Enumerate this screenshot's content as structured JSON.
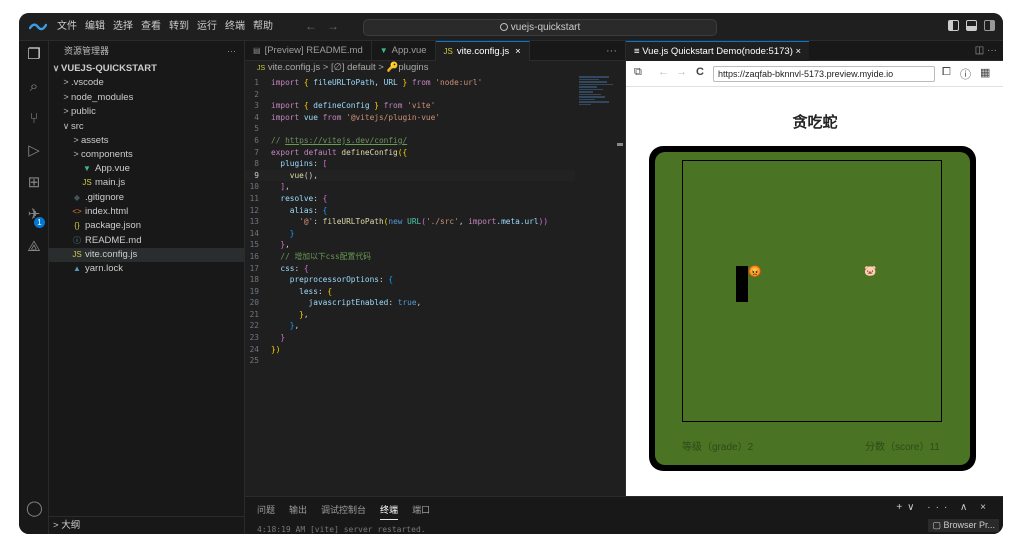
{
  "menu": [
    "文件",
    "编辑",
    "选择",
    "查看",
    "转到",
    "运行",
    "终端",
    "帮助"
  ],
  "nav": {
    "back": "←",
    "forward": "→"
  },
  "search": {
    "text": "vuejs-quickstart"
  },
  "explorer": {
    "header": "资源管理器",
    "more": "···",
    "project": "VUEJS-QUICKSTART",
    "items": [
      {
        "label": ".vscode",
        "chev": ">",
        "icon": "",
        "indent": 1,
        "color": "#cccccc"
      },
      {
        "label": "node_modules",
        "chev": ">",
        "icon": "",
        "indent": 1,
        "color": "#cccccc"
      },
      {
        "label": "public",
        "chev": ">",
        "icon": "",
        "indent": 1,
        "color": "#cccccc"
      },
      {
        "label": "src",
        "chev": "∨",
        "icon": "",
        "indent": 1,
        "color": "#cccccc"
      },
      {
        "label": "assets",
        "chev": ">",
        "icon": "",
        "indent": 2,
        "color": "#cccccc"
      },
      {
        "label": "components",
        "chev": ">",
        "icon": "",
        "indent": 2,
        "color": "#cccccc"
      },
      {
        "label": "App.vue",
        "chev": "",
        "icon": "▼",
        "iconColor": "#41b883",
        "indent": 2,
        "color": "#cccccc"
      },
      {
        "label": "main.js",
        "chev": "",
        "icon": "JS",
        "iconColor": "#cbcb41",
        "indent": 2,
        "color": "#cccccc"
      },
      {
        "label": ".gitignore",
        "chev": "",
        "icon": "◆",
        "iconColor": "#41535b",
        "indent": 1,
        "color": "#cccccc"
      },
      {
        "label": "index.html",
        "chev": "",
        "icon": "<>",
        "iconColor": "#e37933",
        "indent": 1,
        "color": "#cccccc"
      },
      {
        "label": "package.json",
        "chev": "",
        "icon": "{}",
        "iconColor": "#cbcb41",
        "indent": 1,
        "color": "#cccccc"
      },
      {
        "label": "README.md",
        "chev": "",
        "icon": "ⓘ",
        "iconColor": "#519aba",
        "indent": 1,
        "color": "#cccccc"
      },
      {
        "label": "vite.config.js",
        "chev": "",
        "icon": "JS",
        "iconColor": "#cbcb41",
        "indent": 1,
        "color": "#cccccc",
        "selected": true
      },
      {
        "label": "yarn.lock",
        "chev": "",
        "icon": "▲",
        "iconColor": "#519aba",
        "indent": 1,
        "color": "#cccccc"
      }
    ],
    "outline": "大纲"
  },
  "tabs": [
    {
      "label": "[Preview] README.md",
      "icon": "▤",
      "iconColor": "#8a8a8a"
    },
    {
      "label": "App.vue",
      "icon": "▼",
      "iconColor": "#41b883"
    },
    {
      "label": "vite.config.js",
      "icon": "JS",
      "iconColor": "#cbcb41",
      "active": true,
      "close": "×"
    }
  ],
  "breadcrumb": {
    "file": "vite.config.js",
    "sep1": ">",
    "item1": "[∅] default",
    "sep2": ">",
    "item2": "plugins"
  },
  "code": [
    [
      {
        "t": "import ",
        "c": "#c586c0"
      },
      {
        "t": "{ ",
        "c": "#ffd700"
      },
      {
        "t": "fileURLToPath",
        "c": "#9cdcfe"
      },
      {
        "t": ", ",
        "c": "#d4d4d4"
      },
      {
        "t": "URL ",
        "c": "#9cdcfe"
      },
      {
        "t": "} ",
        "c": "#ffd700"
      },
      {
        "t": "from ",
        "c": "#c586c0"
      },
      {
        "t": "'node:url'",
        "c": "#ce9178"
      }
    ],
    [],
    [
      {
        "t": "import ",
        "c": "#c586c0"
      },
      {
        "t": "{ ",
        "c": "#ffd700"
      },
      {
        "t": "defineConfig ",
        "c": "#9cdcfe"
      },
      {
        "t": "} ",
        "c": "#ffd700"
      },
      {
        "t": "from ",
        "c": "#c586c0"
      },
      {
        "t": "'vite'",
        "c": "#ce9178"
      }
    ],
    [
      {
        "t": "import ",
        "c": "#c586c0"
      },
      {
        "t": "vue ",
        "c": "#9cdcfe"
      },
      {
        "t": "from ",
        "c": "#c586c0"
      },
      {
        "t": "'@vitejs/plugin-vue'",
        "c": "#ce9178"
      }
    ],
    [],
    [
      {
        "t": "// ",
        "c": "#6a9955"
      },
      {
        "t": "https://vitejs.dev/config/",
        "c": "#6a9955",
        "u": true
      }
    ],
    [
      {
        "t": "export ",
        "c": "#c586c0"
      },
      {
        "t": "default ",
        "c": "#c586c0"
      },
      {
        "t": "defineConfig",
        "c": "#dcdcaa"
      },
      {
        "t": "({",
        "c": "#ffd700"
      }
    ],
    [
      {
        "t": "  plugins",
        "c": "#9cdcfe"
      },
      {
        "t": ": ",
        "c": "#d4d4d4"
      },
      {
        "t": "[",
        "c": "#da70d6"
      }
    ],
    [
      {
        "t": "    vue",
        "c": "#dcdcaa"
      },
      {
        "t": "(),",
        "c": "#d4d4d4"
      }
    ],
    [
      {
        "t": "  ]",
        "c": "#da70d6"
      },
      {
        "t": ",",
        "c": "#d4d4d4"
      }
    ],
    [
      {
        "t": "  resolve",
        "c": "#9cdcfe"
      },
      {
        "t": ": ",
        "c": "#d4d4d4"
      },
      {
        "t": "{",
        "c": "#da70d6"
      }
    ],
    [
      {
        "t": "    alias",
        "c": "#9cdcfe"
      },
      {
        "t": ": ",
        "c": "#d4d4d4"
      },
      {
        "t": "{",
        "c": "#179fff"
      }
    ],
    [
      {
        "t": "      '@'",
        "c": "#ce9178"
      },
      {
        "t": ": ",
        "c": "#d4d4d4"
      },
      {
        "t": "fileURLToPath",
        "c": "#dcdcaa"
      },
      {
        "t": "(",
        "c": "#ffd700"
      },
      {
        "t": "new ",
        "c": "#569cd6"
      },
      {
        "t": "URL",
        "c": "#4ec9b0"
      },
      {
        "t": "(",
        "c": "#da70d6"
      },
      {
        "t": "'./src'",
        "c": "#ce9178"
      },
      {
        "t": ", ",
        "c": "#d4d4d4"
      },
      {
        "t": "import",
        "c": "#c586c0"
      },
      {
        "t": ".meta.url",
        "c": "#9cdcfe"
      },
      {
        "t": "))",
        "c": "#da70d6"
      }
    ],
    [
      {
        "t": "    }",
        "c": "#179fff"
      }
    ],
    [
      {
        "t": "  }",
        "c": "#da70d6"
      },
      {
        "t": ",",
        "c": "#d4d4d4"
      }
    ],
    [
      {
        "t": "  // 增加以下css配置代码",
        "c": "#6a9955"
      }
    ],
    [
      {
        "t": "  css",
        "c": "#9cdcfe"
      },
      {
        "t": ": ",
        "c": "#d4d4d4"
      },
      {
        "t": "{",
        "c": "#da70d6"
      }
    ],
    [
      {
        "t": "    preprocessorOptions",
        "c": "#9cdcfe"
      },
      {
        "t": ": ",
        "c": "#d4d4d4"
      },
      {
        "t": "{",
        "c": "#179fff"
      }
    ],
    [
      {
        "t": "      less",
        "c": "#9cdcfe"
      },
      {
        "t": ": ",
        "c": "#d4d4d4"
      },
      {
        "t": "{",
        "c": "#ffd700"
      }
    ],
    [
      {
        "t": "        javascriptEnabled",
        "c": "#9cdcfe"
      },
      {
        "t": ": ",
        "c": "#d4d4d4"
      },
      {
        "t": "true",
        "c": "#569cd6"
      },
      {
        "t": ",",
        "c": "#d4d4d4"
      }
    ],
    [
      {
        "t": "      }",
        "c": "#ffd700"
      },
      {
        "t": ",",
        "c": "#d4d4d4"
      }
    ],
    [
      {
        "t": "    }",
        "c": "#179fff"
      },
      {
        "t": ",",
        "c": "#d4d4d4"
      }
    ],
    [
      {
        "t": "  }",
        "c": "#da70d6"
      }
    ],
    [
      {
        "t": "})",
        "c": "#ffd700"
      }
    ],
    []
  ],
  "current_line": 9,
  "panel": {
    "tabs": [
      "问题",
      "输出",
      "调试控制台",
      "终端",
      "端口"
    ],
    "active_tab": "终端",
    "actions": "+∨ ··· ∧ ×",
    "terminal_line": "4:18:19 AM [vite] server restarted.",
    "browser_preview": "Browser Pr..."
  },
  "preview": {
    "tab_label": "Vue.js Quickstart Demo(node:5173)",
    "tab_icon": "≡",
    "tab_close": "×",
    "url": "https://zaqfab-bknnvl-5173.preview.myide.io",
    "game": {
      "title": "贪吃蛇",
      "grade_label": "等级（grade）2",
      "score_label": "分数（score）11",
      "head_icon": "😡",
      "food_icon": "🐷"
    }
  },
  "colors": {
    "accent": "#0078d4",
    "board": "#4a7324",
    "board_text": "#2f4a18"
  }
}
